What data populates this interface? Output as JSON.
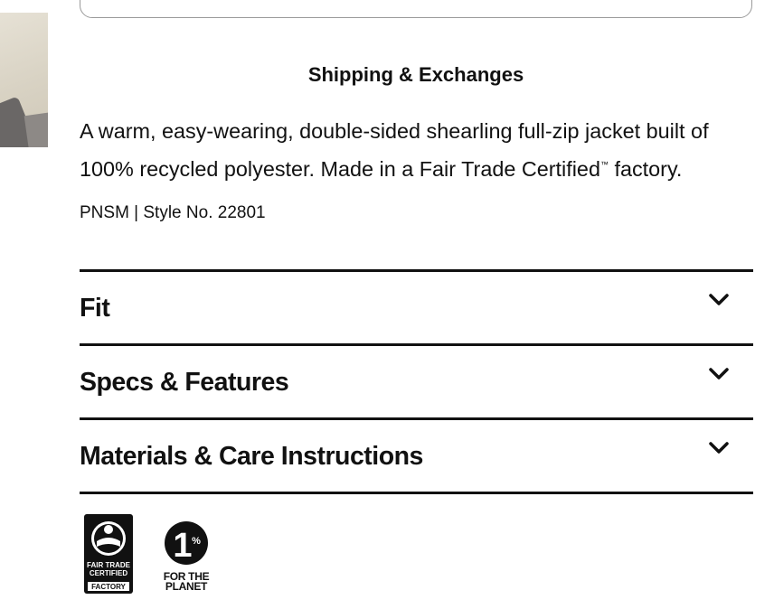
{
  "shipping": {
    "label": "Shipping & Exchanges"
  },
  "product": {
    "description_line1": "A warm, easy-wearing, double-sided shearling full-zip jacket built of",
    "description_line2_a": "100% recycled polyester. Made in a Fair Trade Certified",
    "description_tm": "™",
    "description_line2_b": " factory.",
    "style_info": "PNSM | Style No. 22801"
  },
  "accordion": {
    "items": [
      {
        "label": "Fit",
        "icon": "chevron-down-icon"
      },
      {
        "label": "Specs & Features",
        "icon": "chevron-down-icon"
      },
      {
        "label": "Materials & Care Instructions",
        "icon": "chevron-down-icon"
      }
    ]
  },
  "badges": {
    "fair_trade_line1": "FAIR TRADE",
    "fair_trade_line2": "CERTIFIED",
    "fair_trade_line3": "FACTORY",
    "planet_number": "1",
    "planet_percent": "%",
    "planet_line1": "FOR THE",
    "planet_line2": "PLANET"
  },
  "colors": {
    "text": "#111111",
    "divider": "#111111",
    "background": "#ffffff"
  }
}
